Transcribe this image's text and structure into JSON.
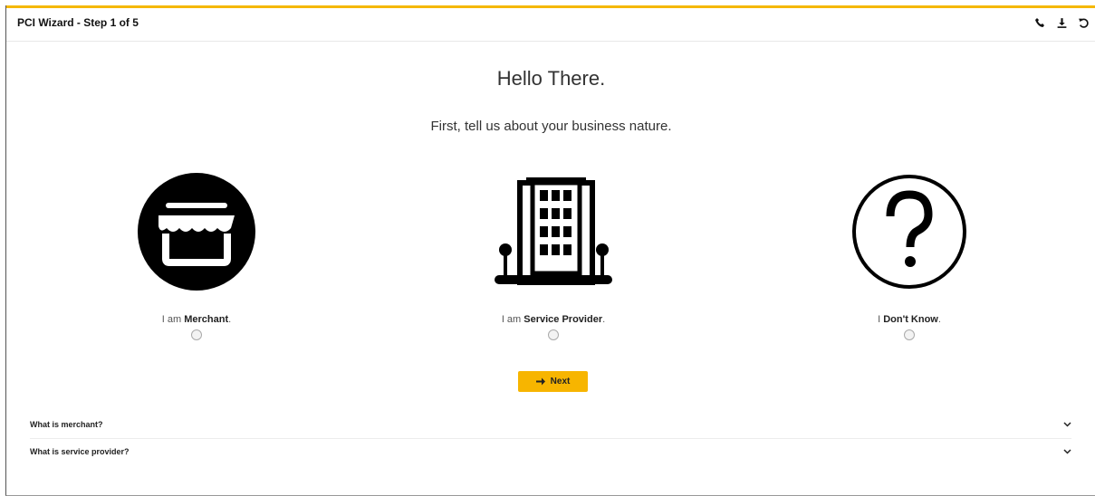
{
  "header": {
    "title": "PCI Wizard -  Step 1 of 5",
    "tools": [
      "phone-icon",
      "download-icon",
      "refresh-icon"
    ]
  },
  "main": {
    "heading": "Hello There.",
    "subheading": "First, tell us about your business nature.",
    "options": [
      {
        "prefix": "I am ",
        "strong": "Merchant",
        "suffix": ".",
        "icon": "storefront-icon"
      },
      {
        "prefix": "I am ",
        "strong": "Service Provider",
        "suffix": ".",
        "icon": "building-icon"
      },
      {
        "prefix": "I ",
        "strong": "Don't Know",
        "suffix": ".",
        "icon": "question-icon"
      }
    ],
    "next_label": "Next"
  },
  "faq": [
    {
      "question": "What is merchant?"
    },
    {
      "question": "What is service provider?"
    }
  ],
  "colors": {
    "accent": "#f5b800",
    "button": "#f7b500"
  }
}
